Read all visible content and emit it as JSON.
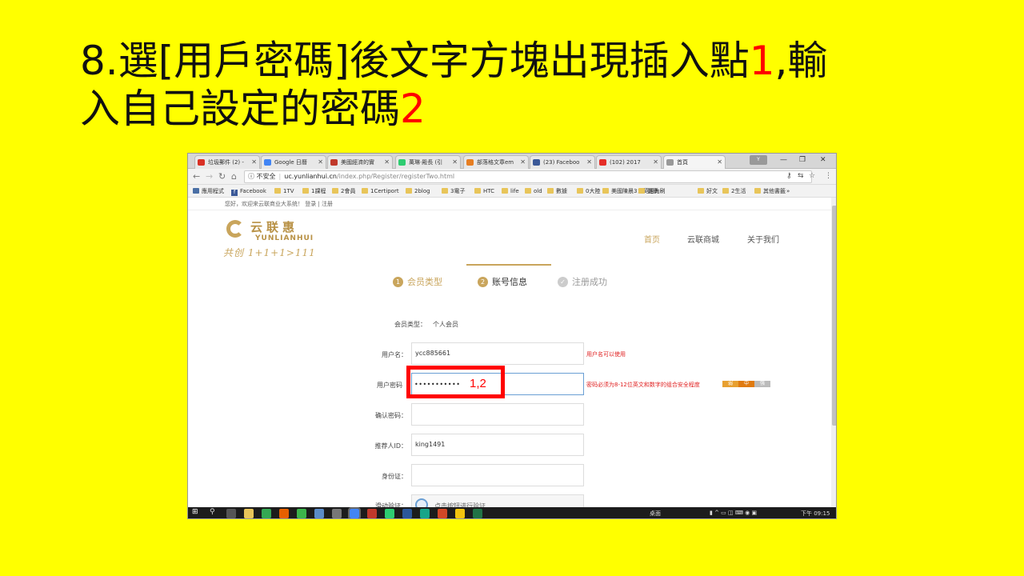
{
  "slide": {
    "title_line1_prefix": "8.選[用戶密碼]後文字方塊出現插入點",
    "title_num1": "1",
    "title_line1_suffix": ",輸",
    "title_line2_prefix": "入自己設定的密碼",
    "title_num2": "2"
  },
  "browser": {
    "tabs": [
      {
        "label": "垃圾郵件 (2) -",
        "color": "#d93025"
      },
      {
        "label": "Google 日曆",
        "color": "#4285f4"
      },
      {
        "label": "美國經濟的實",
        "color": "#c0392b"
      },
      {
        "label": "萬琳·殿長 (引",
        "color": "#2ecc71"
      },
      {
        "label": "部落格文章em",
        "color": "#e67e22"
      },
      {
        "label": "(23) Faceboo",
        "color": "#3b5998"
      },
      {
        "label": "(102) 2017",
        "color": "#e52d27"
      },
      {
        "label": "首頁",
        "color": "#999999"
      }
    ],
    "security_label": "不安全",
    "url_host": "uc.yunlianhui.cn",
    "url_path": "/index.php/Register/registerTwo.html",
    "bookmarks": [
      "應用程式",
      "Facebook",
      "1TV",
      "1課程",
      "2會員",
      "1Certiport",
      "2blog",
      "3電子",
      "HTC",
      "life",
      "old",
      "數據",
      "0大陸",
      "美國陳晨3：英語內刷",
      "健康",
      "好文",
      "2生活",
      "其他書籤"
    ]
  },
  "site": {
    "welcome": "您好，欢迎来云联商业大系统！  登录  |  注册",
    "logo_cn": "云联惠",
    "logo_en": "YUNLIANHUI",
    "logo_slogan": "共创 1+1+1>111",
    "nav": [
      "首页",
      "云联商城",
      "关于我们"
    ],
    "steps": [
      "会员类型",
      "账号信息",
      "注册成功"
    ],
    "step_nums": [
      "1",
      "2",
      "✓"
    ]
  },
  "form": {
    "member_type_label": "会员类型：",
    "member_type_value": "个人会员",
    "username_label": "用户名：",
    "username_value": "ycc885661",
    "username_hint": "用户名可以使用",
    "password_label": "用户密码",
    "password_value": "•••••••••••",
    "password_hint": "密码必须为8-12位英文和数字的组合安全程度",
    "strength": [
      "弱",
      "中",
      "强"
    ],
    "confirm_label": "确认密码：",
    "referrer_label": "推荐人ID：",
    "referrer_value": "king1491",
    "idcard_label": "身份证：",
    "captcha_label": "滑动验证：",
    "captcha_text": "点击按钮进行验证"
  },
  "callout": {
    "text": "1,2"
  },
  "taskbar": {
    "desktop_label": "桌面",
    "time": "下午 09:15"
  }
}
